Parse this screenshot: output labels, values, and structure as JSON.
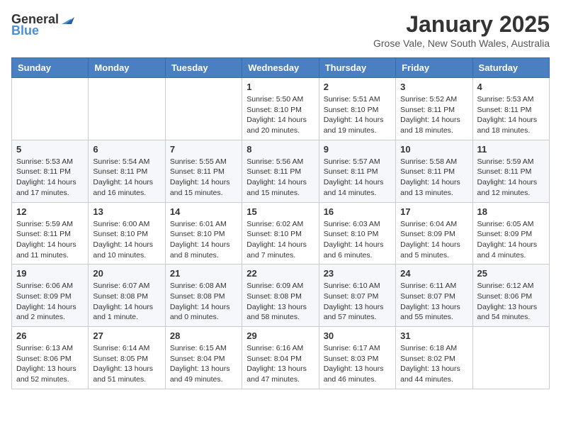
{
  "logo": {
    "general": "General",
    "blue": "Blue"
  },
  "title": "January 2025",
  "location": "Grose Vale, New South Wales, Australia",
  "weekdays": [
    "Sunday",
    "Monday",
    "Tuesday",
    "Wednesday",
    "Thursday",
    "Friday",
    "Saturday"
  ],
  "weeks": [
    [
      {
        "day": "",
        "info": ""
      },
      {
        "day": "",
        "info": ""
      },
      {
        "day": "",
        "info": ""
      },
      {
        "day": "1",
        "info": "Sunrise: 5:50 AM\nSunset: 8:10 PM\nDaylight: 14 hours and 20 minutes."
      },
      {
        "day": "2",
        "info": "Sunrise: 5:51 AM\nSunset: 8:10 PM\nDaylight: 14 hours and 19 minutes."
      },
      {
        "day": "3",
        "info": "Sunrise: 5:52 AM\nSunset: 8:11 PM\nDaylight: 14 hours and 18 minutes."
      },
      {
        "day": "4",
        "info": "Sunrise: 5:53 AM\nSunset: 8:11 PM\nDaylight: 14 hours and 18 minutes."
      }
    ],
    [
      {
        "day": "5",
        "info": "Sunrise: 5:53 AM\nSunset: 8:11 PM\nDaylight: 14 hours and 17 minutes."
      },
      {
        "day": "6",
        "info": "Sunrise: 5:54 AM\nSunset: 8:11 PM\nDaylight: 14 hours and 16 minutes."
      },
      {
        "day": "7",
        "info": "Sunrise: 5:55 AM\nSunset: 8:11 PM\nDaylight: 14 hours and 15 minutes."
      },
      {
        "day": "8",
        "info": "Sunrise: 5:56 AM\nSunset: 8:11 PM\nDaylight: 14 hours and 15 minutes."
      },
      {
        "day": "9",
        "info": "Sunrise: 5:57 AM\nSunset: 8:11 PM\nDaylight: 14 hours and 14 minutes."
      },
      {
        "day": "10",
        "info": "Sunrise: 5:58 AM\nSunset: 8:11 PM\nDaylight: 14 hours and 13 minutes."
      },
      {
        "day": "11",
        "info": "Sunrise: 5:59 AM\nSunset: 8:11 PM\nDaylight: 14 hours and 12 minutes."
      }
    ],
    [
      {
        "day": "12",
        "info": "Sunrise: 5:59 AM\nSunset: 8:11 PM\nDaylight: 14 hours and 11 minutes."
      },
      {
        "day": "13",
        "info": "Sunrise: 6:00 AM\nSunset: 8:10 PM\nDaylight: 14 hours and 10 minutes."
      },
      {
        "day": "14",
        "info": "Sunrise: 6:01 AM\nSunset: 8:10 PM\nDaylight: 14 hours and 8 minutes."
      },
      {
        "day": "15",
        "info": "Sunrise: 6:02 AM\nSunset: 8:10 PM\nDaylight: 14 hours and 7 minutes."
      },
      {
        "day": "16",
        "info": "Sunrise: 6:03 AM\nSunset: 8:10 PM\nDaylight: 14 hours and 6 minutes."
      },
      {
        "day": "17",
        "info": "Sunrise: 6:04 AM\nSunset: 8:09 PM\nDaylight: 14 hours and 5 minutes."
      },
      {
        "day": "18",
        "info": "Sunrise: 6:05 AM\nSunset: 8:09 PM\nDaylight: 14 hours and 4 minutes."
      }
    ],
    [
      {
        "day": "19",
        "info": "Sunrise: 6:06 AM\nSunset: 8:09 PM\nDaylight: 14 hours and 2 minutes."
      },
      {
        "day": "20",
        "info": "Sunrise: 6:07 AM\nSunset: 8:08 PM\nDaylight: 14 hours and 1 minute."
      },
      {
        "day": "21",
        "info": "Sunrise: 6:08 AM\nSunset: 8:08 PM\nDaylight: 14 hours and 0 minutes."
      },
      {
        "day": "22",
        "info": "Sunrise: 6:09 AM\nSunset: 8:08 PM\nDaylight: 13 hours and 58 minutes."
      },
      {
        "day": "23",
        "info": "Sunrise: 6:10 AM\nSunset: 8:07 PM\nDaylight: 13 hours and 57 minutes."
      },
      {
        "day": "24",
        "info": "Sunrise: 6:11 AM\nSunset: 8:07 PM\nDaylight: 13 hours and 55 minutes."
      },
      {
        "day": "25",
        "info": "Sunrise: 6:12 AM\nSunset: 8:06 PM\nDaylight: 13 hours and 54 minutes."
      }
    ],
    [
      {
        "day": "26",
        "info": "Sunrise: 6:13 AM\nSunset: 8:06 PM\nDaylight: 13 hours and 52 minutes."
      },
      {
        "day": "27",
        "info": "Sunrise: 6:14 AM\nSunset: 8:05 PM\nDaylight: 13 hours and 51 minutes."
      },
      {
        "day": "28",
        "info": "Sunrise: 6:15 AM\nSunset: 8:04 PM\nDaylight: 13 hours and 49 minutes."
      },
      {
        "day": "29",
        "info": "Sunrise: 6:16 AM\nSunset: 8:04 PM\nDaylight: 13 hours and 47 minutes."
      },
      {
        "day": "30",
        "info": "Sunrise: 6:17 AM\nSunset: 8:03 PM\nDaylight: 13 hours and 46 minutes."
      },
      {
        "day": "31",
        "info": "Sunrise: 6:18 AM\nSunset: 8:02 PM\nDaylight: 13 hours and 44 minutes."
      },
      {
        "day": "",
        "info": ""
      }
    ]
  ]
}
